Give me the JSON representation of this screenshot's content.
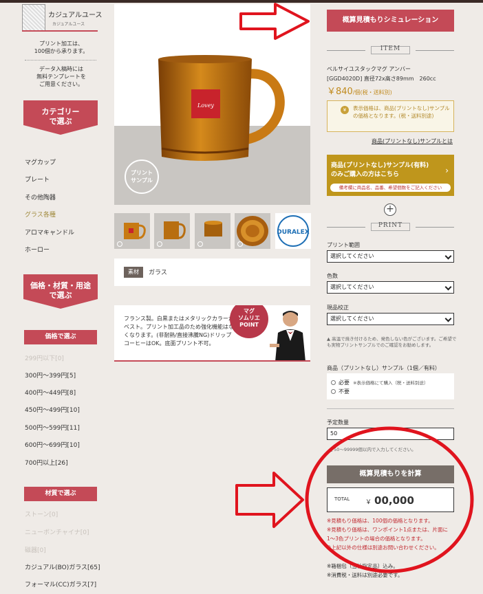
{
  "sidebar": {
    "logo_title": "カジュアルユース",
    "logo_sub": "カジュアルユース",
    "note1": [
      "プリント加工は、",
      "100個から承ります。"
    ],
    "note2": [
      "データ入稿時には",
      "無料テンプレートを",
      "ご用意ください。"
    ],
    "category_banner": [
      "カテゴリー",
      "で選ぶ"
    ],
    "categories": [
      "マグカップ",
      "プレート",
      "その他陶器",
      "グラス各種",
      "アロマキャンドル",
      "ホーロー"
    ],
    "price_banner": [
      "価格・材質・用途",
      "で選ぶ"
    ],
    "price_header": "価格で選ぶ",
    "prices": [
      "299円以下[0]",
      "300円〜399円[5]",
      "400円〜449円[8]",
      "450円〜499円[10]",
      "500円〜599円[11]",
      "600円〜699円[10]",
      "700円以上[26]"
    ],
    "material_header": "材質で選ぶ",
    "materials": [
      "ストーン[0]",
      "ニューボンチャイナ[0]",
      "磁器[0]",
      "カジュアル(BO)ガラス[65]",
      "フォーマル(CC)ガラス[7]"
    ]
  },
  "main": {
    "sample_badge": [
      "プリント",
      "サンプル"
    ],
    "material_label": "素材",
    "material_value": "ガラス",
    "promo_text": "フランス製。白黒またはメタリックカラーがベスト。プリント加工品のため強化機能はなくなります。(非耐熱/直接沸騰NG)ドリップコーヒーはOK。底面プリント不可。",
    "promo_badge": [
      "マグ",
      "ソムリエ",
      "POINT"
    ],
    "thumb_logo": "DURALEX"
  },
  "right": {
    "simulation_button": "概算見積もりシミュレーション",
    "item_label": "ITEM",
    "product_name": "ベルサイユスタックマグ アンバー",
    "product_spec": "[GGD4020D] 直径72x高さ89mm　260cc",
    "price": "￥840",
    "price_unit": "/個(税・送料別)",
    "price_note": "表示価格は、商品(プリントなし)サンプルの価格となります。(税・送料別途)",
    "yen_icon": "¥",
    "sample_link": "商品(プリントなし)サンプルとは",
    "sample_button": [
      "商品(プリントなし)サンプル(有料)",
      "のみご購入の方はこちら"
    ],
    "sample_button_note": "備考欄に商品名、品番、希望個数をご記入ください",
    "print_label": "PRINT",
    "print_range_label": "プリント範囲",
    "print_range_value": "選択してください",
    "colors_label": "色数",
    "colors_value": "選択してください",
    "proof_label": "現品校正",
    "proof_value": "選択してください",
    "proof_note": "▲ 高温で焼き付けるため、発色しない色がございます。ご希望でも実物プリントサンプルでのご確認をお勧めします。",
    "sample_option_label": "商品（プリントなし）サンプル（1個／有料）",
    "radio_required": "必要",
    "radio_required_note": "※表示価格にて購入（税・送料別途）",
    "radio_not_required": "不要",
    "qty_label": "予定数量",
    "qty_value": "50",
    "qty_note": "▲ 50〜99999個以内で入力してください。",
    "calc_button": "概算見積もりを計算",
    "total_label": "TOTAL",
    "total_currency": "￥",
    "total_value": "00,000",
    "red_notes": [
      "※見積もり価格は、100個の価格となります。",
      "※見積もり価格は、ワンポイント1点または、片面に1〜3色プリントの場合の価格となります。",
      "※上記以外の仕様は別途お問い合わせください。"
    ],
    "black_notes": [
      "※箱梱包（当社指定品）込み。",
      "※消費税・送料は別途必要です。"
    ]
  },
  "colors": {
    "accent_red": "#c44a57",
    "gold": "#bf961c",
    "annotation_red": "#e0141e"
  }
}
